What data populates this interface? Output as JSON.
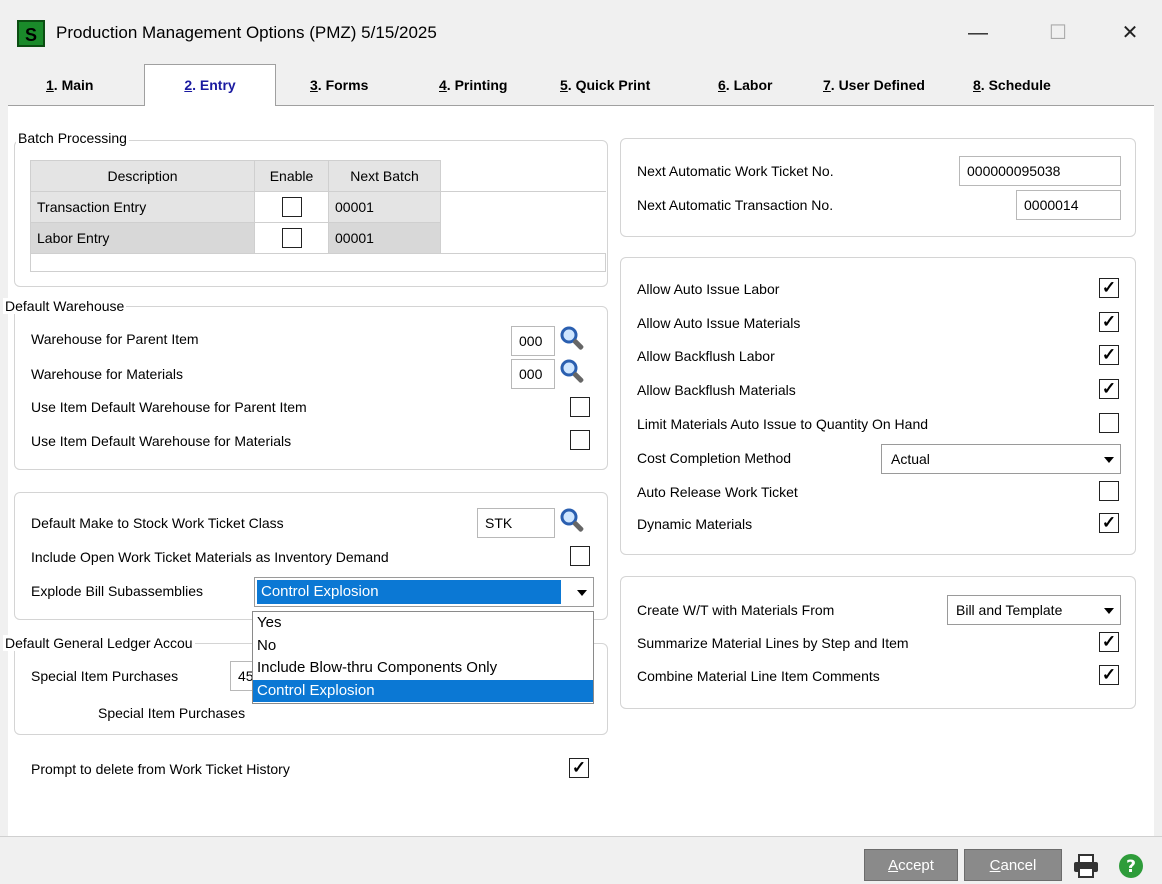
{
  "window": {
    "icon_letter": "S",
    "title": "Production Management Options (PMZ) 5/15/2025",
    "minimize": "—",
    "maximize": "☐",
    "close": "✕"
  },
  "tabs": [
    {
      "key": "1",
      "label": ". Main",
      "active": false
    },
    {
      "key": "2",
      "label": ". Entry",
      "active": true
    },
    {
      "key": "3",
      "label": ". Forms",
      "active": false
    },
    {
      "key": "4",
      "label": ". Printing",
      "active": false
    },
    {
      "key": "5",
      "label": ". Quick Print",
      "active": false
    },
    {
      "key": "6",
      "label": ". Labor",
      "active": false
    },
    {
      "key": "7",
      "label": ". User Defined",
      "active": false
    },
    {
      "key": "8",
      "label": ". Schedule",
      "active": false
    }
  ],
  "batch": {
    "title": "Batch Processing",
    "headers": [
      "Description",
      "Enable",
      "Next Batch"
    ],
    "rows": [
      {
        "description": "Transaction Entry",
        "enable": false,
        "next_batch": "00001"
      },
      {
        "description": "Labor Entry",
        "enable": false,
        "next_batch": "00001"
      }
    ]
  },
  "warehouse": {
    "title": "Default Warehouse",
    "parent_label": "Warehouse for Parent Item",
    "parent_value": "000",
    "materials_label": "Warehouse for Materials",
    "materials_value": "000",
    "use_parent_label": "Use Item Default Warehouse for Parent Item",
    "use_parent_checked": false,
    "use_materials_label": "Use Item Default Warehouse for Materials",
    "use_materials_checked": false
  },
  "stock": {
    "class_label": "Default Make to Stock Work Ticket Class",
    "class_value": "STK",
    "include_label": "Include Open Work Ticket Materials as Inventory Demand",
    "include_checked": false,
    "explode_label": "Explode Bill Subassemblies",
    "explode_value": "Control Explosion",
    "explode_options": [
      "Yes",
      "No",
      "Include Blow-thru Components Only",
      "Control Explosion"
    ]
  },
  "gl": {
    "title": "Default General Ledger Accou",
    "special_label": "Special Item Purchases",
    "special_value": "45",
    "special_desc": "Special Item Purchases"
  },
  "prompt_delete": {
    "label": "Prompt to delete from Work Ticket History",
    "checked": true
  },
  "numbers": {
    "work_ticket_label": "Next Automatic Work Ticket No.",
    "work_ticket_value": "000000095038",
    "transaction_label": "Next Automatic Transaction No.",
    "transaction_value": "0000014"
  },
  "options": {
    "auto_issue_labor": {
      "label": "Allow Auto Issue Labor",
      "checked": true
    },
    "auto_issue_materials": {
      "label": "Allow Auto Issue Materials",
      "checked": true
    },
    "backflush_labor": {
      "label": "Allow Backflush Labor",
      "checked": true
    },
    "backflush_materials": {
      "label": "Allow Backflush Materials",
      "checked": true
    },
    "limit_materials": {
      "label": "Limit Materials Auto Issue to Quantity On Hand",
      "checked": false
    },
    "cost_method_label": "Cost Completion Method",
    "cost_method_value": "Actual",
    "auto_release": {
      "label": "Auto Release Work Ticket",
      "checked": false
    },
    "dynamic_materials": {
      "label": "Dynamic Materials",
      "checked": true
    }
  },
  "wt": {
    "create_label": "Create W/T with Materials From",
    "create_value": "Bill and Template",
    "summarize": {
      "label": "Summarize Material Lines by Step and Item",
      "checked": true
    },
    "combine": {
      "label": "Combine Material Line Item Comments",
      "checked": true
    }
  },
  "footer": {
    "accept_key": "A",
    "accept_rest": "ccept",
    "cancel_key": "C",
    "cancel_rest": "ancel"
  },
  "colors": {
    "accent": "#0b78d4",
    "button": "#8a8a8a",
    "help": "#2e9c3a"
  },
  "icons": [
    "search-icon",
    "printer-icon",
    "help-icon"
  ]
}
